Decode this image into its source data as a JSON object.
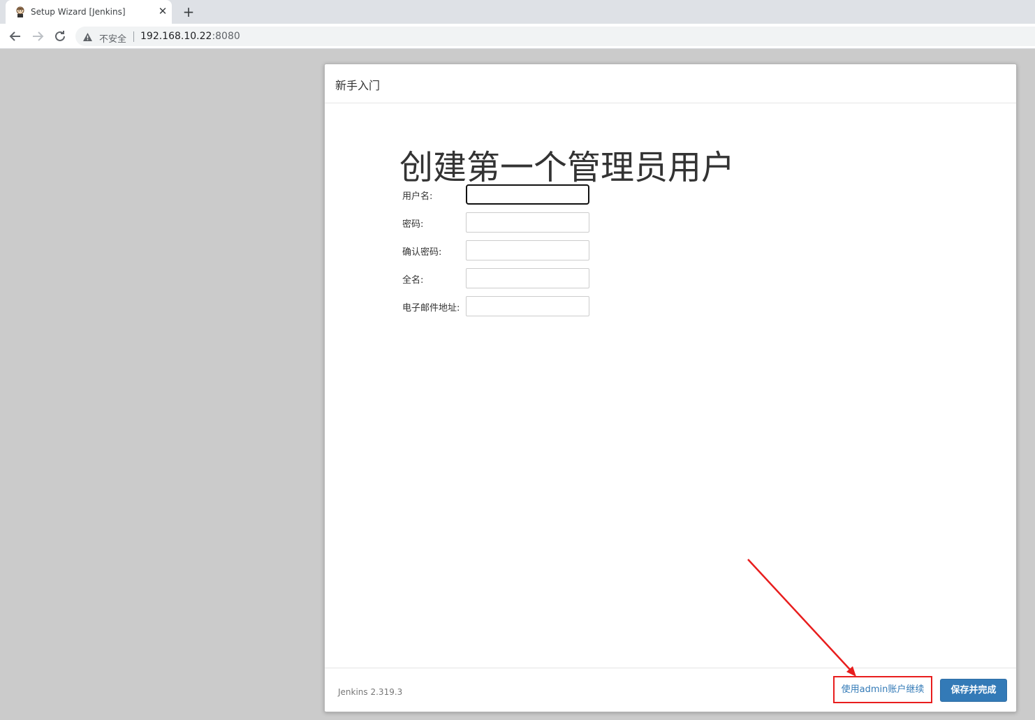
{
  "browser": {
    "tab_title": "Setup Wizard [Jenkins]",
    "tab_close": "✕",
    "new_tab": "+",
    "security_label": "不安全",
    "url_host": "192.168.10.22",
    "url_port": ":8080"
  },
  "dialog": {
    "title": "新手入门",
    "heading": "创建第一个管理员用户",
    "fields": [
      {
        "label": "用户名:",
        "value": ""
      },
      {
        "label": "密码:",
        "value": ""
      },
      {
        "label": "确认密码:",
        "value": ""
      },
      {
        "label": "全名:",
        "value": ""
      },
      {
        "label": "电子邮件地址:",
        "value": ""
      }
    ],
    "footer": {
      "version": "Jenkins 2.319.3",
      "skip_label": "使用admin账户继续",
      "save_label": "保存并完成"
    }
  },
  "colors": {
    "primary": "#337ab7",
    "annotation": "#e81d1d",
    "page_background": "#cbcbcb"
  }
}
